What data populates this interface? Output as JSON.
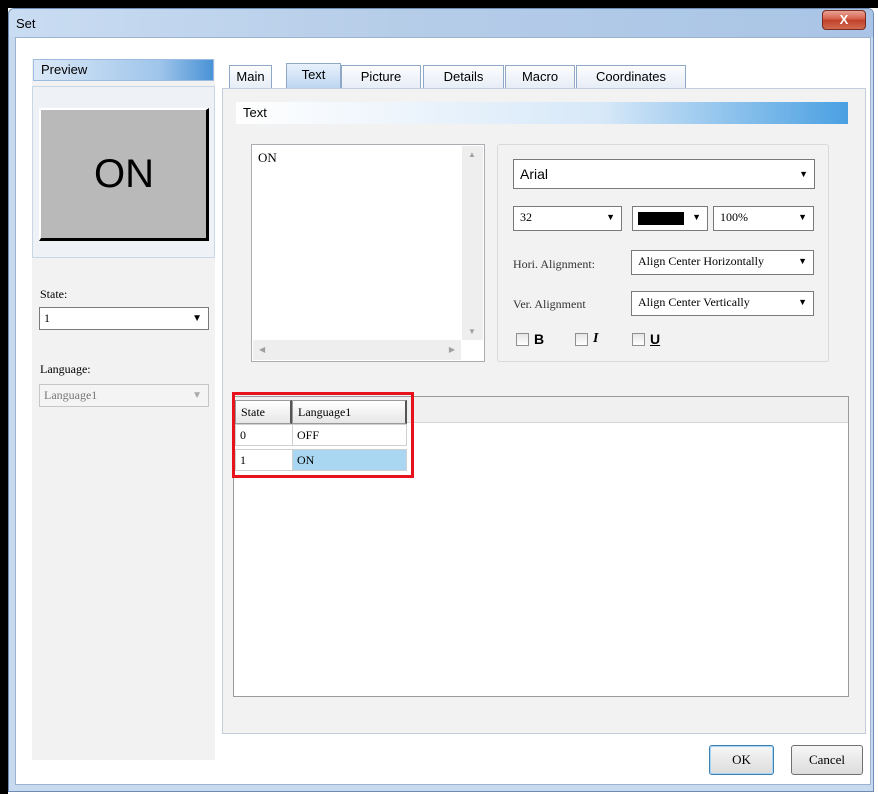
{
  "window": {
    "title": "Set",
    "close_glyph": "X"
  },
  "preview": {
    "header": "Preview",
    "button_text": "ON"
  },
  "state": {
    "label": "State:",
    "value": "1"
  },
  "language": {
    "label": "Language:",
    "value": "Language1"
  },
  "tabs": [
    {
      "label": "Main",
      "active": false
    },
    {
      "label": "Text",
      "active": true
    },
    {
      "label": "Picture",
      "active": false
    },
    {
      "label": "Details",
      "active": false
    },
    {
      "label": "Macro",
      "active": false
    },
    {
      "label": "Coordinates",
      "active": false
    }
  ],
  "text_section": {
    "header": "Text",
    "content": "ON",
    "font": "Arial",
    "size": "32",
    "color": "#000000",
    "scale": "100%",
    "hori_label": "Hori. Alignment:",
    "hori_value": "Align Center Horizontally",
    "vert_label": "Ver. Alignment",
    "vert_value": "Align Center Vertically",
    "bold": "B",
    "italic": "I",
    "underline": "U"
  },
  "grid": {
    "columns": [
      "State",
      "Language1"
    ],
    "rows": [
      {
        "state": "0",
        "text": "OFF"
      },
      {
        "state": "1",
        "text": "ON"
      }
    ],
    "selected_row": 1,
    "highlight_color": "#e8121c"
  },
  "buttons": {
    "ok": "OK",
    "cancel": "Cancel"
  }
}
